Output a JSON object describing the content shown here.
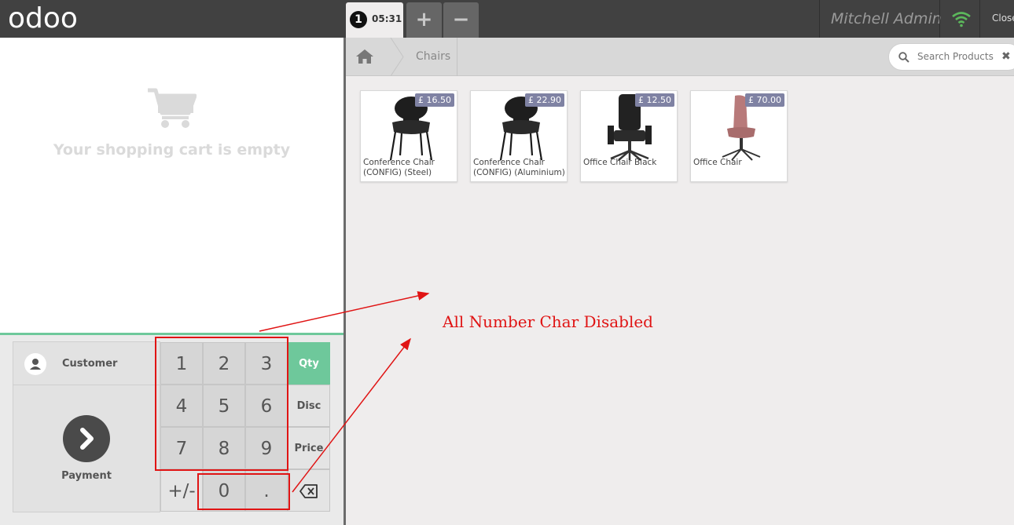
{
  "header": {
    "logo": "odoo",
    "order_number": "1",
    "order_time": "05:31",
    "add_order_label": "+",
    "remove_order_label": "−",
    "user_name": "Mitchell Admin",
    "close_label": "Close"
  },
  "cart": {
    "empty_message": "Your shopping cart is empty"
  },
  "controls": {
    "customer_label": "Customer",
    "payment_label": "Payment"
  },
  "numpad": {
    "keys": [
      "1",
      "2",
      "3",
      "4",
      "5",
      "6",
      "7",
      "8",
      "9"
    ],
    "sign_key": "+/-",
    "zero_key": "0",
    "dot_key": ".",
    "modes": [
      "Qty",
      "Disc",
      "Price"
    ],
    "active_mode": "Qty"
  },
  "breadcrumb": {
    "category": "Chairs"
  },
  "search": {
    "placeholder": "Search Products",
    "clear_label": "✖"
  },
  "products": [
    {
      "name": "Conference Chair (CONFIG) (Steel)",
      "price": "£ 16.50"
    },
    {
      "name": "Conference Chair (CONFIG) (Aluminium)",
      "price": "£ 22.90"
    },
    {
      "name": "Office Chair Black",
      "price": "£ 12.50"
    },
    {
      "name": "Office Chair",
      "price": "£ 70.00"
    }
  ],
  "annotation": {
    "text": "All Number Char Disabled"
  },
  "colors": {
    "accent": "#6ec89b",
    "annotation": "#e01414",
    "price_tag": "#7f82a3",
    "topbar": "#414141"
  }
}
